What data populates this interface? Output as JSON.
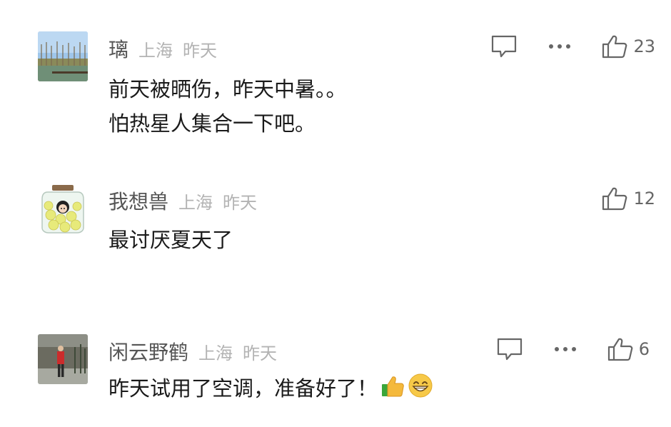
{
  "comments": [
    {
      "username": "璃",
      "location": "上海",
      "time": "昨天",
      "lines": [
        "前天被晒伤，昨天中暑。。",
        "怕热星人集合一下吧。"
      ],
      "likes": "23",
      "has_reply": true,
      "has_more": true
    },
    {
      "username": "我想兽",
      "location": "上海",
      "time": "昨天",
      "lines": [
        "最讨厌夏天了"
      ],
      "likes": "12",
      "has_reply": false,
      "has_more": false
    },
    {
      "username": "闲云野鹤",
      "location": "上海",
      "time": "昨天",
      "lines": [
        "昨天试用了空调，准备好了！"
      ],
      "emojis": [
        "thumbs-up-emoji",
        "grinning-face-emoji"
      ],
      "likes": "6",
      "has_reply": true,
      "has_more": true
    }
  ],
  "icons": {
    "reply": "comment-bubble-icon",
    "more": "more-dots-icon",
    "like": "thumbs-up-outline-icon"
  },
  "colors": {
    "text": "#1a1a1a",
    "username": "#555555",
    "meta": "#b3b3b3",
    "icon": "#666666"
  }
}
